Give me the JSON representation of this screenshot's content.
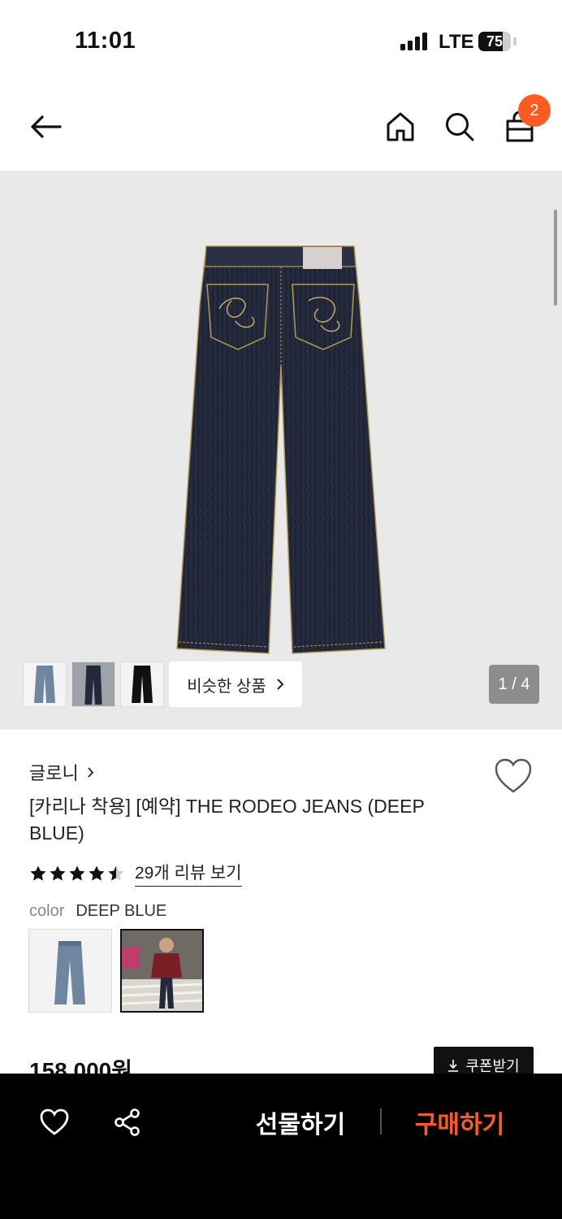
{
  "status_bar": {
    "time": "11:01",
    "network": "LTE",
    "battery": "75",
    "battery_level": 0.75
  },
  "nav": {
    "cart_count": "2"
  },
  "gallery": {
    "similar_label": "비슷한 상품",
    "page_indicator": "1 / 4"
  },
  "product": {
    "brand": "글로니",
    "title": "[카리나 착용] [예약] THE RODEO JEANS (DEEP BLUE)",
    "rating": 4.5,
    "review_link": "29개 리뷰 보기",
    "color_label": "color",
    "color_value": "DEEP BLUE",
    "price": "158,000원",
    "coupon_label": "쿠폰받기"
  },
  "bottom_bar": {
    "gift_label": "선물하기",
    "buy_label": "구매하기"
  },
  "colors": {
    "accent": "#ff5a1f",
    "denim_dark": "#23283b",
    "denim_light": "#6e86a0"
  }
}
